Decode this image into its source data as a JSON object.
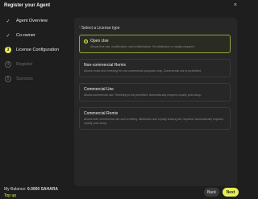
{
  "dialog": {
    "title": "Register your Agent",
    "close_icon": "×"
  },
  "steps": [
    {
      "label": "Agent Overview",
      "state": "done",
      "marker": "✓"
    },
    {
      "label": "Co-owner",
      "state": "done",
      "marker": "✓"
    },
    {
      "label": "License Configuration",
      "state": "active",
      "marker": "3"
    },
    {
      "label": "Register",
      "state": "todo",
      "marker": "4"
    },
    {
      "label": "Success",
      "state": "todo",
      "marker": "5"
    }
  ],
  "license": {
    "heading_required_mark": "*",
    "heading": "Select a License type",
    "selected": "Open Use",
    "options": [
      {
        "title": "Open Use",
        "description": "Allows free use, modification, and redistribution. No attribution or royalty required."
      },
      {
        "title": "Non-commercial Remix",
        "description": "Allows reuse and remixing for non-commercial purposes only. Commercial use is prohibited."
      },
      {
        "title": "Commercial Use",
        "description": "Allows commercial use. Remixing is not permitted. Automatically requires royalty post setup."
      },
      {
        "title": "Commercial Remix",
        "description": "Allows both commercial use and remixing. Attribution and royalty sharing are required. Automatically requires royalty post setup."
      }
    ]
  },
  "footer": {
    "balance_label": "My Balance:",
    "balance_value": "0.0000 SAHARA",
    "topup_label": "Top up",
    "back_label": "Back",
    "next_label": "Next"
  },
  "colors": {
    "background": "#1e1e1e",
    "panel": "#272727",
    "accent": "#e6f050",
    "selected_border": "#9aa33a"
  }
}
